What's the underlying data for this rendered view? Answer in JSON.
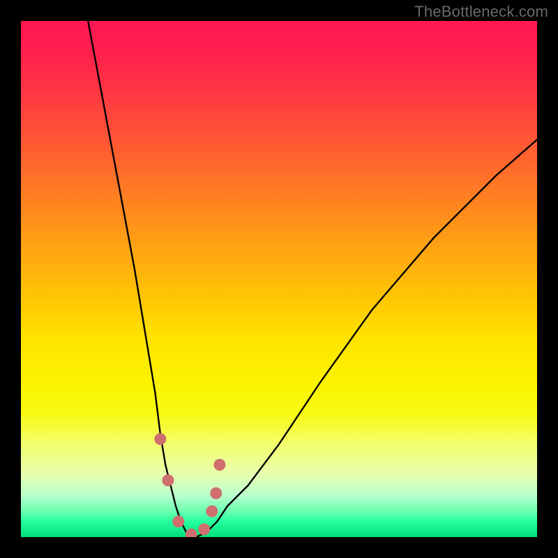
{
  "watermark": "TheBottleneck.com",
  "chart_data": {
    "type": "line",
    "title": "",
    "xlabel": "",
    "ylabel": "",
    "xlim": [
      0,
      100
    ],
    "ylim": [
      0,
      100
    ],
    "series": [
      {
        "name": "bottleneck-curve",
        "x": [
          13,
          16,
          19,
          22,
          24,
          26,
          27,
          28,
          29,
          30,
          31,
          32,
          33,
          34,
          36,
          38,
          40,
          44,
          50,
          58,
          68,
          80,
          92,
          100
        ],
        "values": [
          100,
          84,
          68,
          52,
          40,
          28,
          20,
          14,
          10,
          6,
          3,
          1,
          0,
          0,
          1,
          3,
          6,
          10,
          18,
          30,
          44,
          58,
          70,
          77
        ]
      }
    ],
    "markers": {
      "name": "highlight-points",
      "x": [
        27.0,
        28.5,
        30.5,
        33.0,
        35.5,
        37.0,
        37.8,
        38.5
      ],
      "values": [
        19.0,
        11.0,
        3.0,
        0.5,
        1.5,
        5.0,
        8.5,
        14.0
      ]
    },
    "colors": {
      "curve": "#000000",
      "marker": "#cf6e6e",
      "gradient_top": "#ff1752",
      "gradient_bottom": "#00e07a"
    }
  }
}
